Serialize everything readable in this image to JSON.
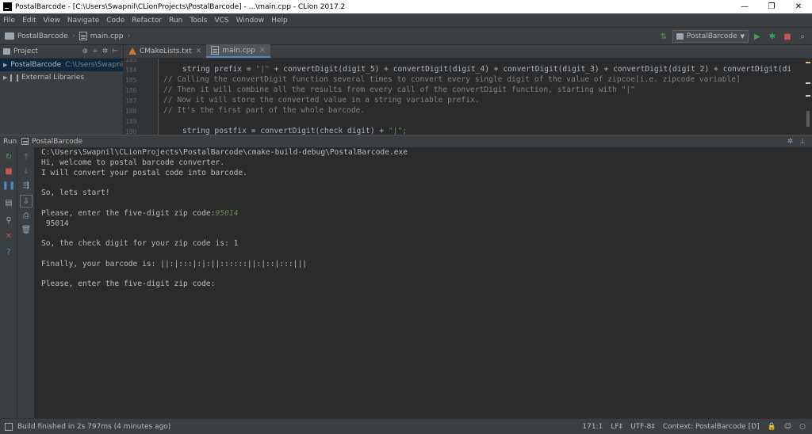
{
  "window": {
    "title": "PostalBarcode - [C:\\Users\\Swapnil\\CLionProjects\\PostalBarcode] - ...\\main.cpp - CLion 2017.2",
    "minimize": "—",
    "restore": "❐",
    "close": "✕"
  },
  "menu": [
    "File",
    "Edit",
    "View",
    "Navigate",
    "Code",
    "Refactor",
    "Run",
    "Tools",
    "VCS",
    "Window",
    "Help"
  ],
  "navbar": {
    "project": "PostalBarcode",
    "file": "main.cpp",
    "run_config": "PostalBarcode"
  },
  "project_panel": {
    "title": "Project",
    "root_name": "PostalBarcode",
    "root_path": "C:\\Users\\Swapnil",
    "libraries": "External Libraries"
  },
  "tabs": [
    {
      "label": "CMakeLists.txt"
    },
    {
      "label": "main.cpp"
    }
  ],
  "editor": {
    "line_numbers": [
      "183",
      "184",
      "185",
      "186",
      "187",
      "188",
      "189",
      "190"
    ],
    "lines": {
      "l184_a": "string prefix = ",
      "l184_b": "\"|\"",
      "l184_c": " + convertDigit(digit_5) + convertDigit(digit_4) + convertDigit(digit_3) + convertDigit(digit_2) + convertDigit(di",
      "l185": "// Calling the convertDigit function several times to convert every single digit of the value of zipcoe[i.e. zipcode variable]",
      "l186": "// Then it will combine all the results from every call of the convertDigit function, starting with \"|\"",
      "l187": "// Now it will store the converted value in a string variable prefix.",
      "l188": "// It's the first part of the whole barcode.",
      "l190_a": "string postfix = convertDigit(check_digit) + ",
      "l190_b": "\"|\";"
    }
  },
  "run": {
    "label": "Run",
    "config": "PostalBarcode"
  },
  "console": {
    "path": "C:\\Users\\Swapnil\\CLionProjects\\PostalBarcode\\cmake-build-debug\\PostalBarcode.exe",
    "welcome": "Hi, welcome to postal barcode converter.",
    "convert": "I will convert your postal code into barcode.",
    "start": "So, lets start!",
    "prompt1": "Please, enter the five-digit zip code:",
    "input1": "95014",
    "echo": " 95014",
    "check": "So, the check digit for your zip code is: 1",
    "barcode": "Finally, your barcode is: ||:|:::|:|:||::::::||:|::|:::|||",
    "prompt2": "Please, enter the five-digit zip code:"
  },
  "status": {
    "message": "Build finished in 2s 797ms (4 minutes ago)",
    "position": "171:1",
    "line_sep": "LF‡",
    "encoding": "UTF-8‡",
    "context": "Context: PostalBarcode [D]"
  },
  "colors": {
    "background": "#2b2b2b",
    "panel": "#3c3f41",
    "run_green": "#499c54",
    "stop_red": "#c75450",
    "accent_blue": "#4a88c7"
  }
}
